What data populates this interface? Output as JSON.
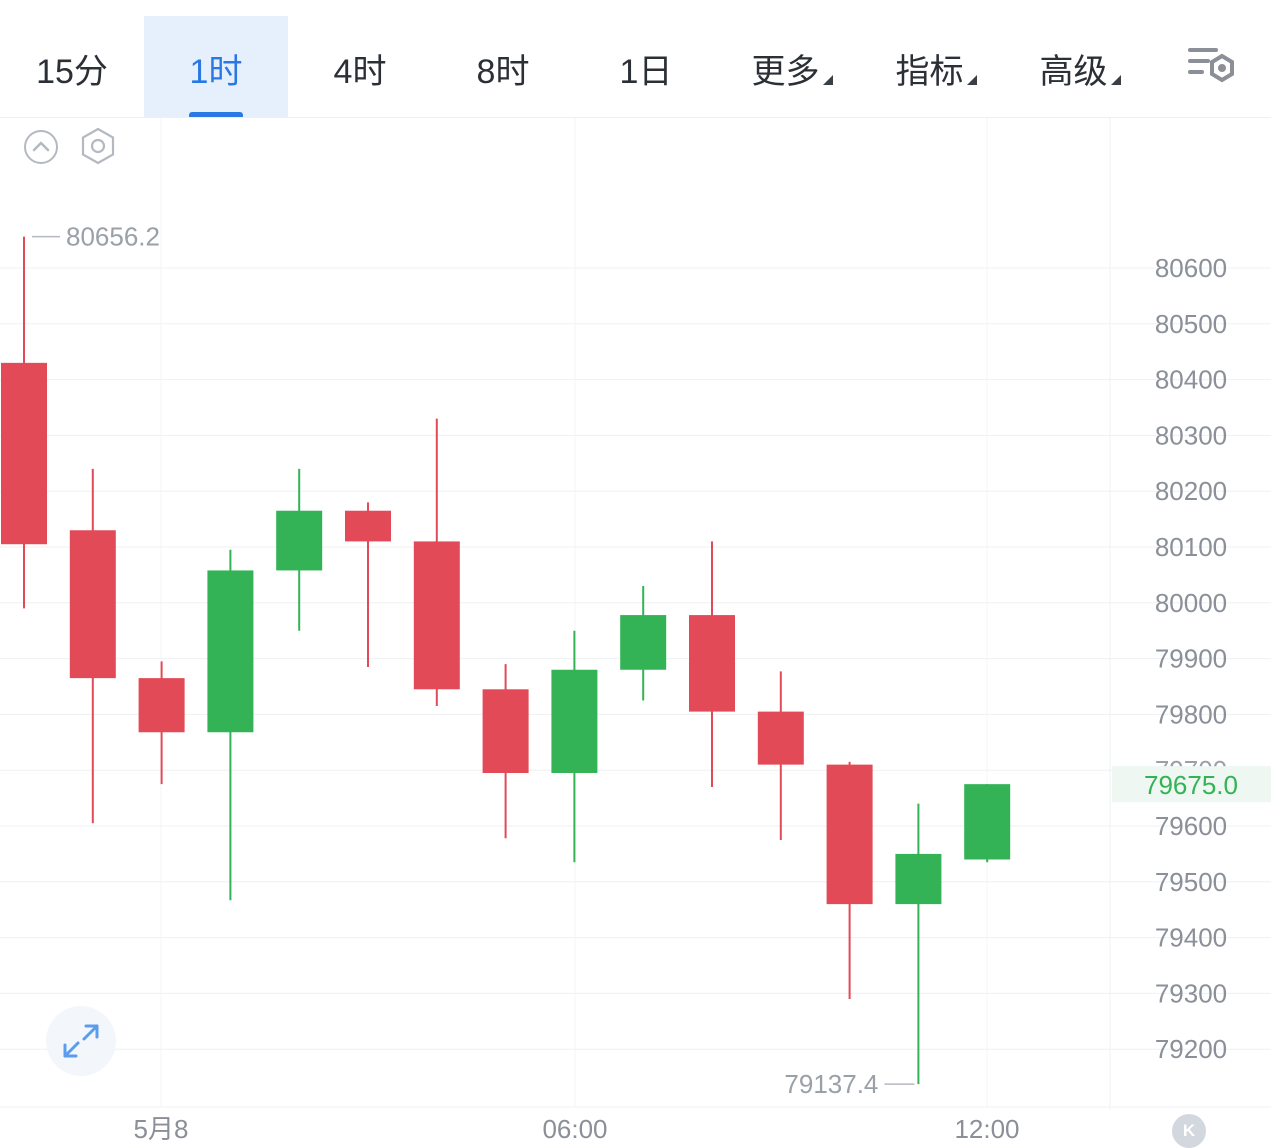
{
  "tabs": [
    {
      "label": "15分",
      "active": false,
      "dropdown": false
    },
    {
      "label": "1时",
      "active": true,
      "dropdown": false
    },
    {
      "label": "4时",
      "active": false,
      "dropdown": false
    },
    {
      "label": "8时",
      "active": false,
      "dropdown": false
    },
    {
      "label": "1日",
      "active": false,
      "dropdown": false
    },
    {
      "label": "更多",
      "active": false,
      "dropdown": true
    },
    {
      "label": "指标",
      "active": false,
      "dropdown": true
    },
    {
      "label": "高级",
      "active": false,
      "dropdown": true
    }
  ],
  "colors": {
    "accent": "#2a78e4",
    "up": "#34b356",
    "down": "#e34a57",
    "grid": "#eef0f3",
    "axis_text": "#8a8f98"
  },
  "icons": {
    "settings": "chart-settings-icon",
    "collapse": "chevron-up-circle-icon",
    "hexagon": "hexagon-settings-icon",
    "expand": "expand-arrows-icon",
    "k": "k-line-icon"
  },
  "k_button_label": "K",
  "chart_data": {
    "type": "candlestick",
    "interval": "1时",
    "y_ticks": [
      80600,
      80500,
      80400,
      80300,
      80200,
      80100,
      80000,
      79900,
      79800,
      79700,
      79600,
      79500,
      79400,
      79300,
      79200
    ],
    "ylim": [
      79050,
      80760
    ],
    "x_labels": [
      "5月8",
      "06:00",
      "12:00"
    ],
    "current_price": "79675.0",
    "high_label": "80656.2",
    "low_label": "79137.4",
    "candles": [
      {
        "open": 80430,
        "high": 80656.2,
        "low": 79990,
        "close": 80105
      },
      {
        "open": 80130,
        "high": 80240,
        "low": 79605,
        "close": 79865
      },
      {
        "open": 79865,
        "high": 79895,
        "low": 79675,
        "close": 79768
      },
      {
        "open": 79768,
        "high": 80095,
        "low": 79467,
        "close": 80058
      },
      {
        "open": 80058,
        "high": 80240,
        "low": 79950,
        "close": 80165
      },
      {
        "open": 80165,
        "high": 80180,
        "low": 79885,
        "close": 80110
      },
      {
        "open": 80110,
        "high": 80330,
        "low": 79815,
        "close": 79845
      },
      {
        "open": 79845,
        "high": 79890,
        "low": 79578,
        "close": 79695
      },
      {
        "open": 79695,
        "high": 79950,
        "low": 79535,
        "close": 79880
      },
      {
        "open": 79880,
        "high": 80030,
        "low": 79825,
        "close": 79978
      },
      {
        "open": 79978,
        "high": 80110,
        "low": 79670,
        "close": 79805
      },
      {
        "open": 79805,
        "high": 79877,
        "low": 79575,
        "close": 79710
      },
      {
        "open": 79710,
        "high": 79715,
        "low": 79290,
        "close": 79460
      },
      {
        "open": 79460,
        "high": 79640,
        "low": 79137.4,
        "close": 79550
      },
      {
        "open": 79540,
        "high": 79675,
        "low": 79535,
        "close": 79675
      }
    ]
  }
}
